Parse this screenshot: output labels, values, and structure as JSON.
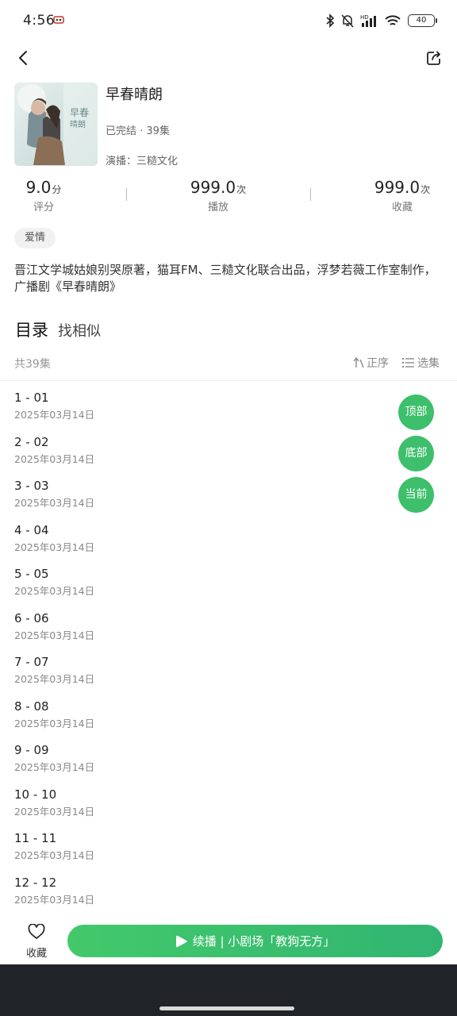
{
  "status_bar": {
    "time": "4:56",
    "battery": "40",
    "icons": [
      "notification-icon",
      "bluetooth-icon",
      "mute-icon",
      "signal-icon",
      "wifi-icon",
      "battery-icon"
    ]
  },
  "header": {
    "back_icon": "chevron-left-icon",
    "share_icon": "share-icon"
  },
  "album": {
    "title": "早春晴朗",
    "status": "已完结 · 39集",
    "cast": "演播：三糙文化",
    "cover_title_text": "早春晴朗"
  },
  "stats": [
    {
      "value": "9.0",
      "unit": "分",
      "label": "评分"
    },
    {
      "value": "999.0",
      "unit": "次",
      "label": "播放"
    },
    {
      "value": "999.0",
      "unit": "次",
      "label": "收藏"
    }
  ],
  "tag": "爱情",
  "description": "晋江文学城姑娘别哭原著，猫耳FM、三糙文化联合出品，浮梦若薇工作室制作，广播剧《早春晴朗》",
  "catalog": {
    "tab_catalog": "目录",
    "tab_similar": "找相似",
    "count": "共39集",
    "order_label": "正序",
    "select_label": "选集"
  },
  "episodes": [
    {
      "title": "1 - 01",
      "date": "2025年03月14日"
    },
    {
      "title": "2 - 02",
      "date": "2025年03月14日"
    },
    {
      "title": "3 - 03",
      "date": "2025年03月14日"
    },
    {
      "title": "4 - 04",
      "date": "2025年03月14日"
    },
    {
      "title": "5 - 05",
      "date": "2025年03月14日"
    },
    {
      "title": "6 - 06",
      "date": "2025年03月14日"
    },
    {
      "title": "7 - 07",
      "date": "2025年03月14日"
    },
    {
      "title": "8 - 08",
      "date": "2025年03月14日"
    },
    {
      "title": "9 - 09",
      "date": "2025年03月14日"
    },
    {
      "title": "10 - 10",
      "date": "2025年03月14日"
    },
    {
      "title": "11 - 11",
      "date": "2025年03月14日"
    },
    {
      "title": "12 - 12",
      "date": "2025年03月14日"
    }
  ],
  "float_buttons": {
    "top": "顶部",
    "bottom": "底部",
    "current": "当前"
  },
  "bottom_bar": {
    "fav_label": "收藏",
    "play_label": "续播 | 小剧场「教狗无方」"
  },
  "colors": {
    "accent": "#3dbf6b",
    "nav_background": "#202328"
  }
}
